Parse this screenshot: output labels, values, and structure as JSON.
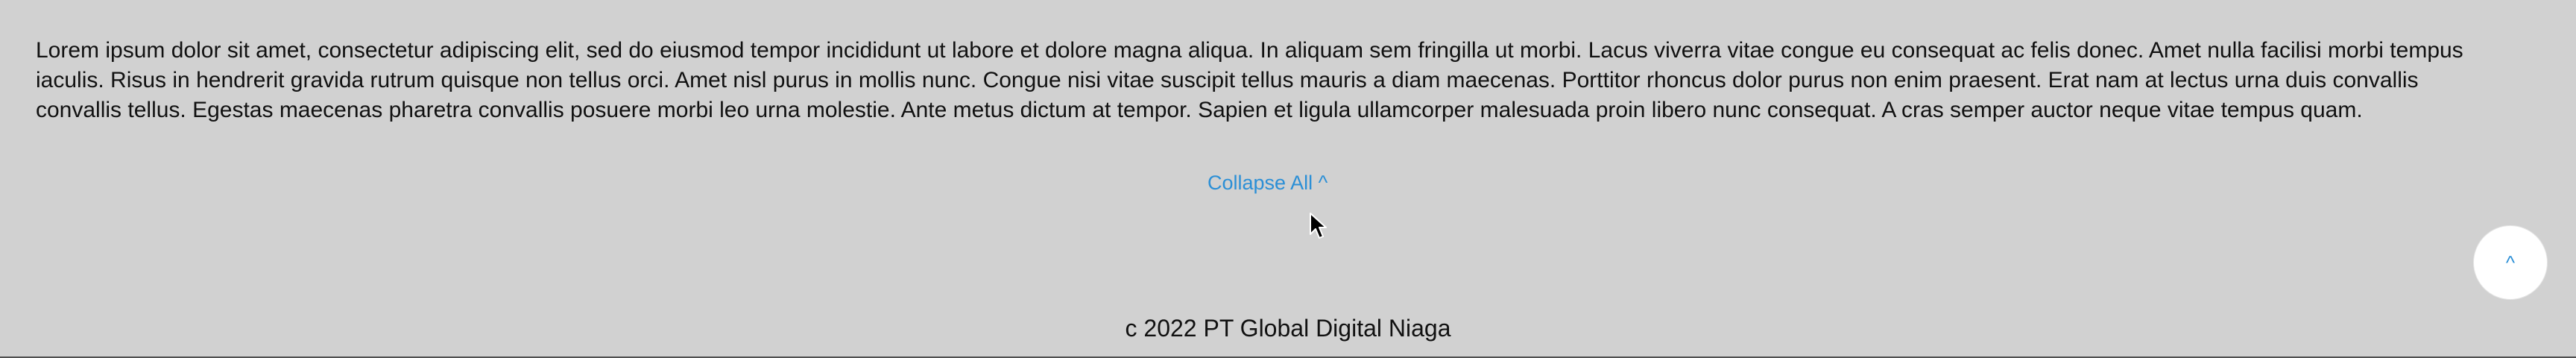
{
  "content": {
    "paragraph": "Lorem ipsum dolor sit amet, consectetur adipiscing elit, sed do eiusmod tempor incididunt ut labore et dolore magna aliqua. In aliquam sem fringilla ut morbi. Lacus viverra vitae congue eu consequat ac felis donec. Amet nulla facilisi morbi tempus iaculis. Risus in hendrerit gravida rutrum quisque non tellus orci. Amet nisl purus in mollis nunc. Congue nisi vitae suscipit tellus mauris a diam maecenas. Porttitor rhoncus dolor purus non enim praesent. Erat nam at lectus urna duis convallis convallis tellus. Egestas maecenas pharetra convallis posuere morbi leo urna molestie. Ante metus dictum at tempor. Sapien et ligula ullamcorper malesuada proin libero nunc consequat. A cras semper auctor neque vitae tempus quam.",
    "collapse_label": "Collapse All ^"
  },
  "scroll_top": {
    "label": "^"
  },
  "footer": {
    "copyright": "c 2022 PT Global Digital Niaga"
  },
  "colors": {
    "background": "#d1d1d1",
    "link": "#2b8fd6",
    "button_bg": "#ffffff"
  },
  "icons": {
    "cursor": "mouse-pointer-icon"
  }
}
